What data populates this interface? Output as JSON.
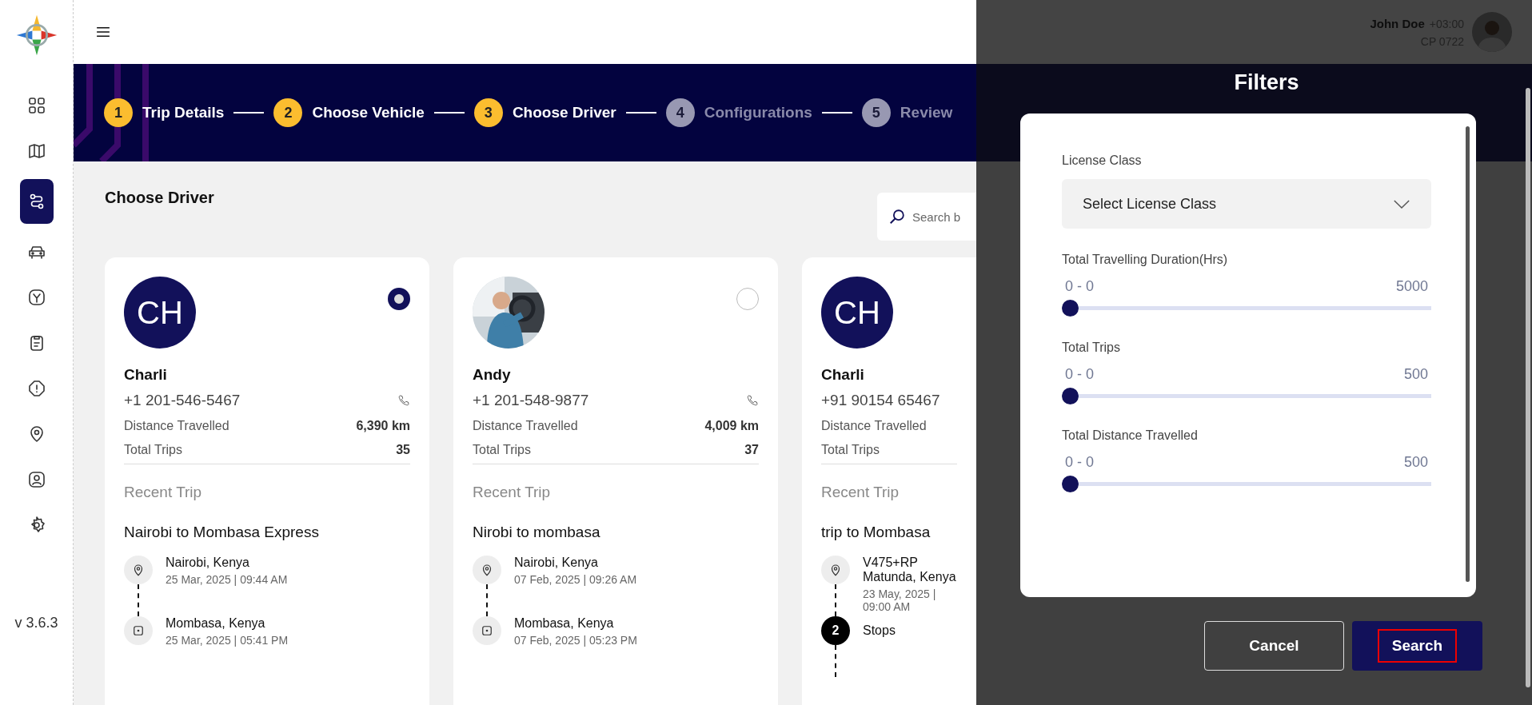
{
  "sidebar": {
    "items": [
      {
        "selected": false
      },
      {
        "selected": false
      },
      {
        "selected": true
      },
      {
        "selected": false
      },
      {
        "selected": false
      },
      {
        "selected": false
      },
      {
        "selected": false
      },
      {
        "selected": false
      },
      {
        "selected": false
      },
      {
        "selected": false
      }
    ],
    "version": "v 3.6.3"
  },
  "header": {
    "user_name": "John Doe",
    "timezone": "+03:00",
    "user_code": "CP 0722"
  },
  "steps": [
    {
      "number": "1",
      "label": "Trip Details",
      "active": true
    },
    {
      "number": "2",
      "label": "Choose Vehicle",
      "active": true
    },
    {
      "number": "3",
      "label": "Choose Driver",
      "active": true
    },
    {
      "number": "4",
      "label": "Configurations",
      "active": false
    },
    {
      "number": "5",
      "label": "Review",
      "active": false
    }
  ],
  "page_title": "Choose Driver",
  "search": {
    "placeholder": "Search b"
  },
  "drivers": [
    {
      "initials": "CH",
      "name": "Charli",
      "phone": "+1 201-546-5467",
      "selected": true,
      "distance_label": "Distance Travelled",
      "distance": "6,390 km",
      "trips_label": "Total Trips",
      "trips": "35",
      "recent_label": "Recent Trip",
      "trip_name": "Nairobi to Mombasa Express",
      "stops": [
        {
          "kind": "origin",
          "place": "Nairobi, Kenya",
          "time": "25 Mar, 2025 | 09:44 AM"
        },
        {
          "kind": "destination",
          "place": "Mombasa, Kenya",
          "time": "25 Mar, 2025 | 05:41 PM"
        }
      ]
    },
    {
      "photo": {
        "kind": "picture"
      },
      "name": "Andy",
      "phone": "+1 201-548-9877",
      "selected": false,
      "distance_label": "Distance Travelled",
      "distance": "4,009 km",
      "trips_label": "Total Trips",
      "trips": "37",
      "recent_label": "Recent Trip",
      "trip_name": "Nirobi to mombasa",
      "stops": [
        {
          "kind": "origin",
          "place": "Nairobi, Kenya",
          "time": "07 Feb, 2025 | 09:26 AM"
        },
        {
          "kind": "destination",
          "place": "Mombasa, Kenya",
          "time": "07 Feb, 2025 | 05:23 PM"
        }
      ]
    },
    {
      "initials": "CH",
      "name": "Charli",
      "phone": "+91 90154 65467",
      "distance_label": "Distance Travelled",
      "trips_label": "Total Trips",
      "recent_label": "Recent Trip",
      "trip_name": "trip to Mombasa",
      "stops": [
        {
          "kind": "origin",
          "place": "V475+RP Matunda, Kenya",
          "time": "23 May, 2025 | 09:00 AM"
        },
        {
          "kind": "count",
          "count": "2",
          "label": "Stops"
        }
      ]
    }
  ],
  "filters": {
    "title": "Filters",
    "license": {
      "label": "License Class",
      "placeholder": "Select License Class"
    },
    "ranges": [
      {
        "label": "Total Travelling Duration(Hrs)",
        "range": "0 - 0",
        "max": "5000",
        "level": 0
      },
      {
        "label": "Total Trips",
        "range": "0 - 0",
        "max": "500",
        "level": 0
      },
      {
        "label": "Total Distance Travelled",
        "range": "0 - 0",
        "max": "500",
        "level": 0
      }
    ],
    "buttons": [
      {
        "label": "Cancel",
        "kind": "secondary",
        "highlighted": false
      },
      {
        "label": "Search",
        "kind": "primary",
        "highlighted": true
      }
    ]
  }
}
